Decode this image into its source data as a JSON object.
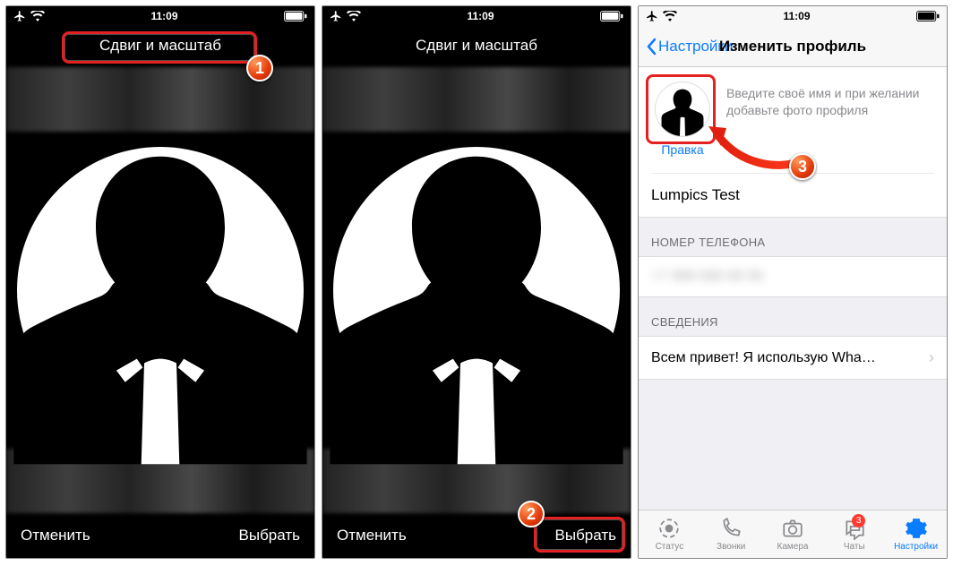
{
  "status": {
    "time": "11:09"
  },
  "crop": {
    "title": "Сдвиг и масштаб",
    "cancel": "Отменить",
    "choose": "Выбрать"
  },
  "badges": {
    "b1": "1",
    "b2": "2",
    "b3": "3"
  },
  "profile": {
    "back": "Настройки",
    "title": "Изменить профиль",
    "edit": "Правка",
    "hint": "Введите своё имя и при желании добавьте фото профиля",
    "name": "Lumpics Test",
    "phone_section": "НОМЕР ТЕЛЕФОНА",
    "phone_value": "+7 999 000 00 00",
    "about_section": "СВЕДЕНИЯ",
    "about_value": "Всем привет! Я использую Wha…"
  },
  "tabs": {
    "status": "Статус",
    "calls": "Звонки",
    "camera": "Камера",
    "chats": "Чаты",
    "settings": "Настройки",
    "chat_badge": "3"
  }
}
